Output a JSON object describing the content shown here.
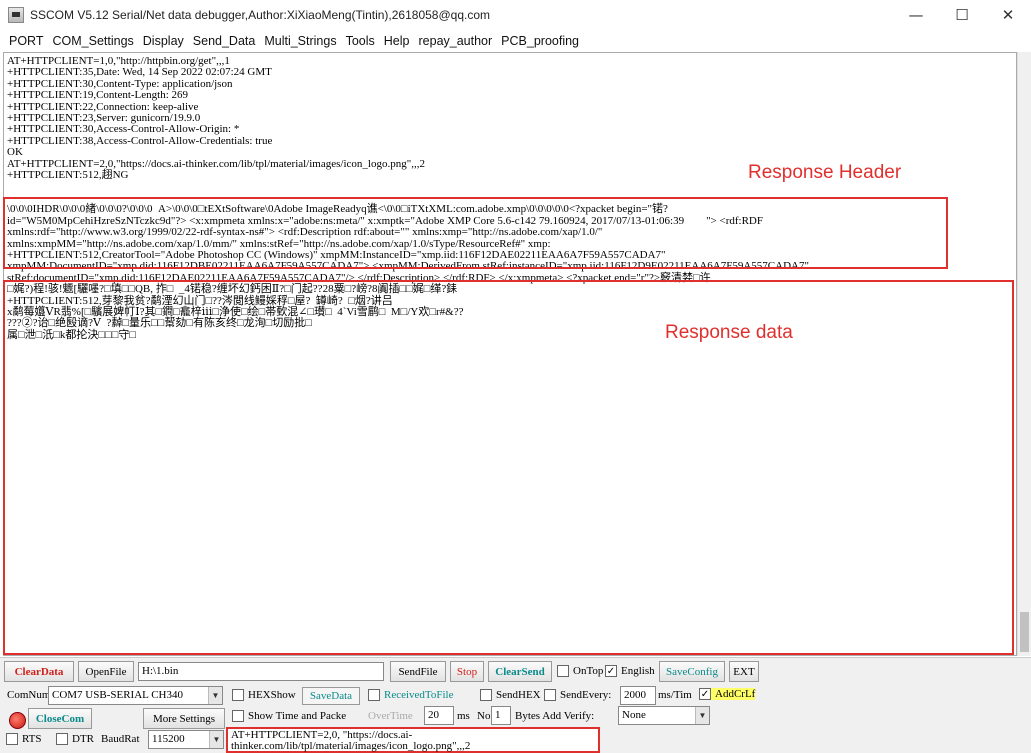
{
  "window": {
    "title": "SSCOM V5.12 Serial/Net data debugger,Author:XiXiaoMeng(Tintin),2618058@qq.com",
    "minimize": "—",
    "maximize": "☐",
    "close": "✕"
  },
  "menu": [
    "PORT",
    "COM_Settings",
    "Display",
    "Send_Data",
    "Multi_Strings",
    "Tools",
    "Help",
    "repay_author",
    "PCB_proofing"
  ],
  "console": {
    "lines": [
      "AT+HTTPCLIENT=1,0,\"http://httpbin.org/get\",,,1",
      "+HTTPCLIENT:35,Date: Wed, 14 Sep 2022 02:07:24 GMT",
      "+HTTPCLIENT:30,Content-Type: application/json",
      "+HTTPCLIENT:19,Content-Length: 269",
      "+HTTPCLIENT:22,Connection: keep-alive",
      "+HTTPCLIENT:23,Server: gunicorn/19.9.0",
      "+HTTPCLIENT:30,Access-Control-Allow-Origin: *",
      "+HTTPCLIENT:38,Access-Control-Allow-Credentials: true",
      "OK",
      "AT+HTTPCLIENT=2,0,\"https://docs.ai-thinker.com/lib/tpl/material/images/icon_logo.png\",,,2",
      "+HTTPCLIENT:512,趐NG",
      "",
      "",
      "\\0\\0\\0IHDR\\0\\0\\0緖\\0\\0\\0?\\0\\0\\0  A>\\0\\0\\0□tEXtSoftware\\0Adobe ImageReadyq谯<\\0\\0□iTXtXML:com.adobe.xmp\\0\\0\\0\\0\\0<?xpacket begin=\"锘?",
      "id=\"W5M0MpCehiHzreSzNTczkc9d\"?> <x:xmpmeta xmlns:x=\"adobe:ns:meta/\" x:xmptk=\"Adobe XMP Core 5.6-c142 79.160924, 2017/07/13-01:06:39        \"> <rdf:RDF",
      "xmlns:rdf=\"http://www.w3.org/1999/02/22-rdf-syntax-ns#\"> <rdf:Description rdf:about=\"\" xmlns:xmp=\"http://ns.adobe.com/xap/1.0/\"",
      "xmlns:xmpMM=\"http://ns.adobe.com/xap/1.0/mm/\" xmlns:stRef=\"http://ns.adobe.com/xap/1.0/sType/ResourceRef#\" xmp:",
      "+HTTPCLIENT:512,CreatorTool=\"Adobe Photoshop CC (Windows)\" xmpMM:InstanceID=\"xmp.iid:116F12DAE02211EAA6A7F59A557CADA7\"",
      "xmpMM:DocumentID=\"xmp.did:116F12DBE02211EAA6A7F59A557CADA7\"> <xmpMM:DerivedFrom stRef:instanceID=\"xmp.iid:116F12D9E02211EAA6A7F59A557CADA7\"",
      "stRef:documentID=\"xmp.did:116F12DAE02211EAA6A7F59A557CADA7\"/> </rdf:Description> </rdf:RDF> </x:xmpmeta> <?xpacket end=\"r\"?>竅清婪□许",
      "□娓?)程!骇!魒[驪嚜?□填□□QB, 拃□  _4锘稳?缠坏幻鈣困Ⅱ?□门起??28粟□?嵭?8阗插□□娓□缂?銇",
      "+HTTPCLIENT:512,芽黎我贫?鹬湮幻山门□??涔閲线鳗婇稃□屋?  罇崎?  □烟?讲吕",
      "x鹬莓孂ⅤR翡%[□驞展婢帄Ⅰ?其□鐧□龕梓ⅰⅱ□浄使□绘□帯歅混∠□瓉□  4`Vi雪鹛□  M□/Y欢□r#&??",
      "???②?诒□绝殹谪?Ⅴ  ?繛□量乐□□幚劾□有陈亥终□龙洵□切励批□",
      "属□泄□汦□k都抡決□□□守□"
    ]
  },
  "annotations": {
    "header_label": "Response Header",
    "data_label": "Response data"
  },
  "toolbar": {
    "clear_data": "ClearData",
    "open_file": "OpenFile",
    "file_path": "H:\\1.bin",
    "send_file": "SendFile",
    "stop": "Stop",
    "clear_send": "ClearSend",
    "on_top": "OnTop",
    "english": "English",
    "save_config": "SaveConfig",
    "ext": "EXT"
  },
  "settings": {
    "com_num_label": "ComNum",
    "com_num_value": "COM7 USB-SERIAL CH340",
    "hex_show": "HEXShow",
    "save_data": "SaveData",
    "received_to_file": "ReceivedToFile",
    "send_hex": "SendHEX",
    "send_every": "SendEvery:",
    "send_every_value": "2000",
    "ms_tim": "ms/Tim",
    "add_crlf": "AddCrLf",
    "close_com": "CloseCom",
    "more_settings": "More Settings",
    "show_time": "Show Time and Packe",
    "overtime": "OverTime",
    "overtime_value": "20",
    "ms": "ms",
    "no_label": "No",
    "no_value": "1",
    "bytes_add_verify": "Bytes Add Verify:",
    "verify_value": "None",
    "rts": "RTS",
    "dtr": "DTR",
    "baud_label": "BaudRat",
    "baud_value": "115200"
  },
  "send_input": "AT+HTTPCLIENT=2,0, \"https://docs.ai-\nthinker.com/lib/tpl/material/images/icon_logo.png\",,,2"
}
